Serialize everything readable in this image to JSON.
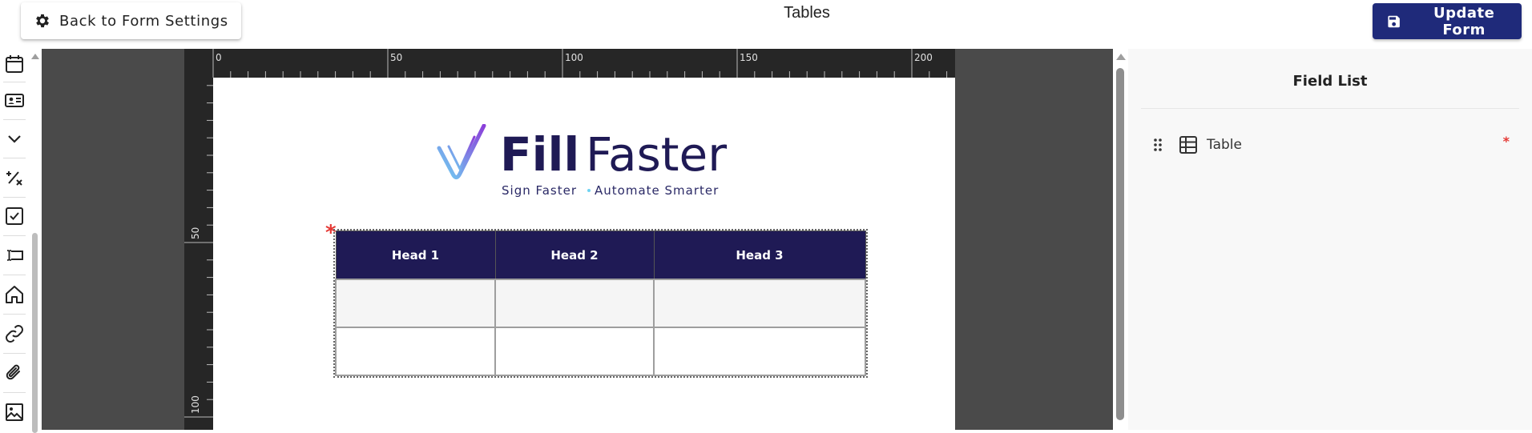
{
  "header": {
    "back_button_label": "Back to Form Settings",
    "title": "Tables",
    "update_button_label": "Update Form"
  },
  "toolbox": {
    "tools": [
      {
        "icon": "calendar-icon"
      },
      {
        "icon": "id-card-icon"
      },
      {
        "icon": "chevron-down-icon"
      },
      {
        "icon": "percent-icon"
      },
      {
        "icon": "checkbox-icon"
      },
      {
        "icon": "text-input-icon"
      },
      {
        "icon": "home-icon"
      },
      {
        "icon": "link-icon"
      },
      {
        "icon": "paperclip-icon"
      },
      {
        "icon": "image-icon"
      }
    ]
  },
  "ruler": {
    "top_labels": [
      "0",
      "50",
      "100",
      "150",
      "200"
    ],
    "left_labels": [
      "50",
      "100"
    ]
  },
  "document": {
    "logo": {
      "word_bold": "Fill",
      "word_light": "Faster",
      "tagline": "Sign Faster",
      "tagline_2": "Automate Smarter"
    },
    "table": {
      "required_marker": "*",
      "headers": [
        "Head 1",
        "Head 2",
        "Head 3"
      ],
      "rows": [
        [
          "",
          "",
          ""
        ],
        [
          "",
          "",
          ""
        ]
      ]
    }
  },
  "field_panel": {
    "title": "Field List",
    "fields": [
      {
        "label": "Table",
        "icon": "table-icon",
        "required_marker": "*"
      }
    ]
  },
  "colors": {
    "primary": "#1f2a7a",
    "table_header": "#1f1a55",
    "required": "#e53935",
    "workspace": "#4a4a4a",
    "ruler": "#262626"
  }
}
